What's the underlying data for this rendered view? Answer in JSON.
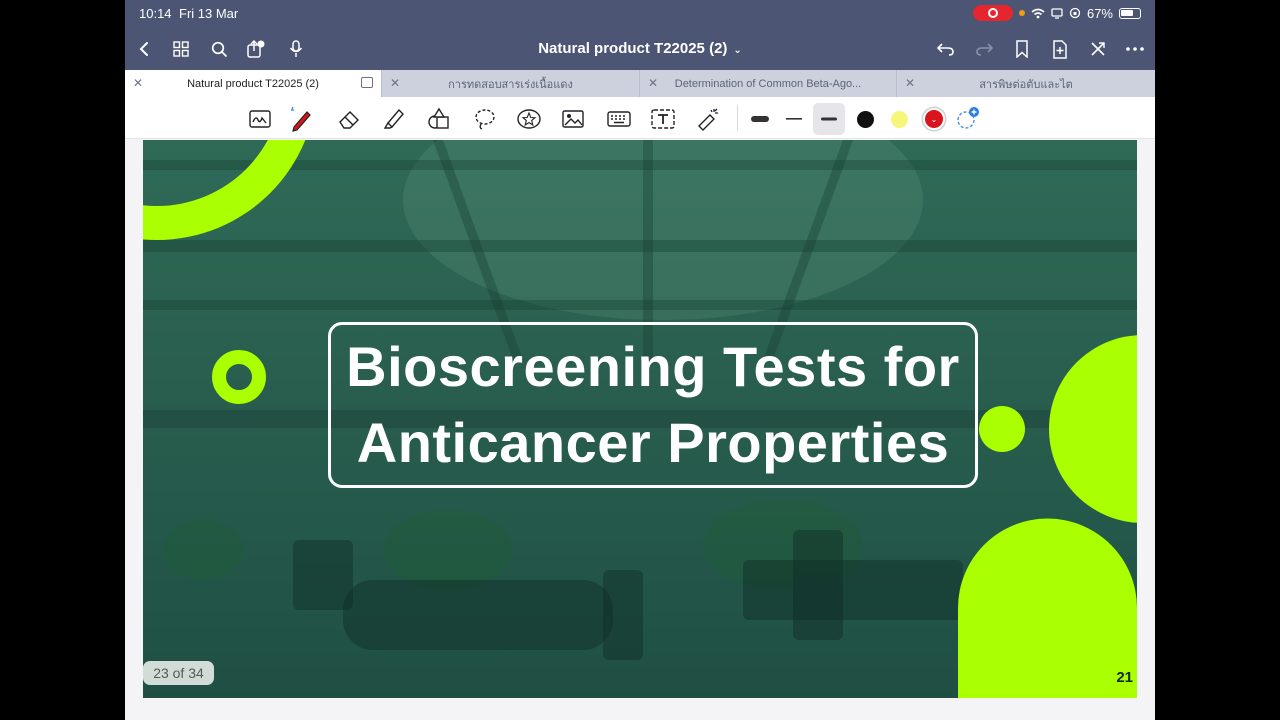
{
  "status_bar": {
    "time": "10:14",
    "date": "Fri 13 Mar",
    "battery": "67%",
    "record_color": "#e5262e"
  },
  "nav": {
    "title": "Natural product T22025 (2)",
    "icons": [
      "back-icon",
      "grid-icon",
      "search-icon",
      "share-icon",
      "microphone-icon",
      "undo-icon",
      "redo-icon",
      "bookmark-icon",
      "add-page-icon",
      "close-editor-icon",
      "more-icon"
    ]
  },
  "tabs": [
    {
      "label": "Natural product T22025 (2)",
      "active": true
    },
    {
      "label": "การทดสอบสารเร่งเนื้อแดง",
      "active": false
    },
    {
      "label": "Determination of Common Beta-Ago...",
      "active": false
    },
    {
      "label": "สารพิษต่อตับและไต",
      "active": false
    }
  ],
  "toolbar": {
    "tools": [
      "handwriting-icon",
      "pen-icon",
      "eraser-icon",
      "highlighter-icon",
      "shapes-icon",
      "lasso-icon",
      "sticker-icon",
      "image-icon",
      "keyboard-icon",
      "text-icon",
      "laser-icon"
    ],
    "colors": [
      "#111111",
      "#f6f77a",
      "#d9141b"
    ]
  },
  "slide": {
    "title_line1": "Bioscreening Tests for",
    "title_line2": "Anticancer Properties",
    "slide_number": "21",
    "accent_color": "#aaff00",
    "background_color": "#2a5f4f"
  },
  "page_indicator": "23 of 34"
}
